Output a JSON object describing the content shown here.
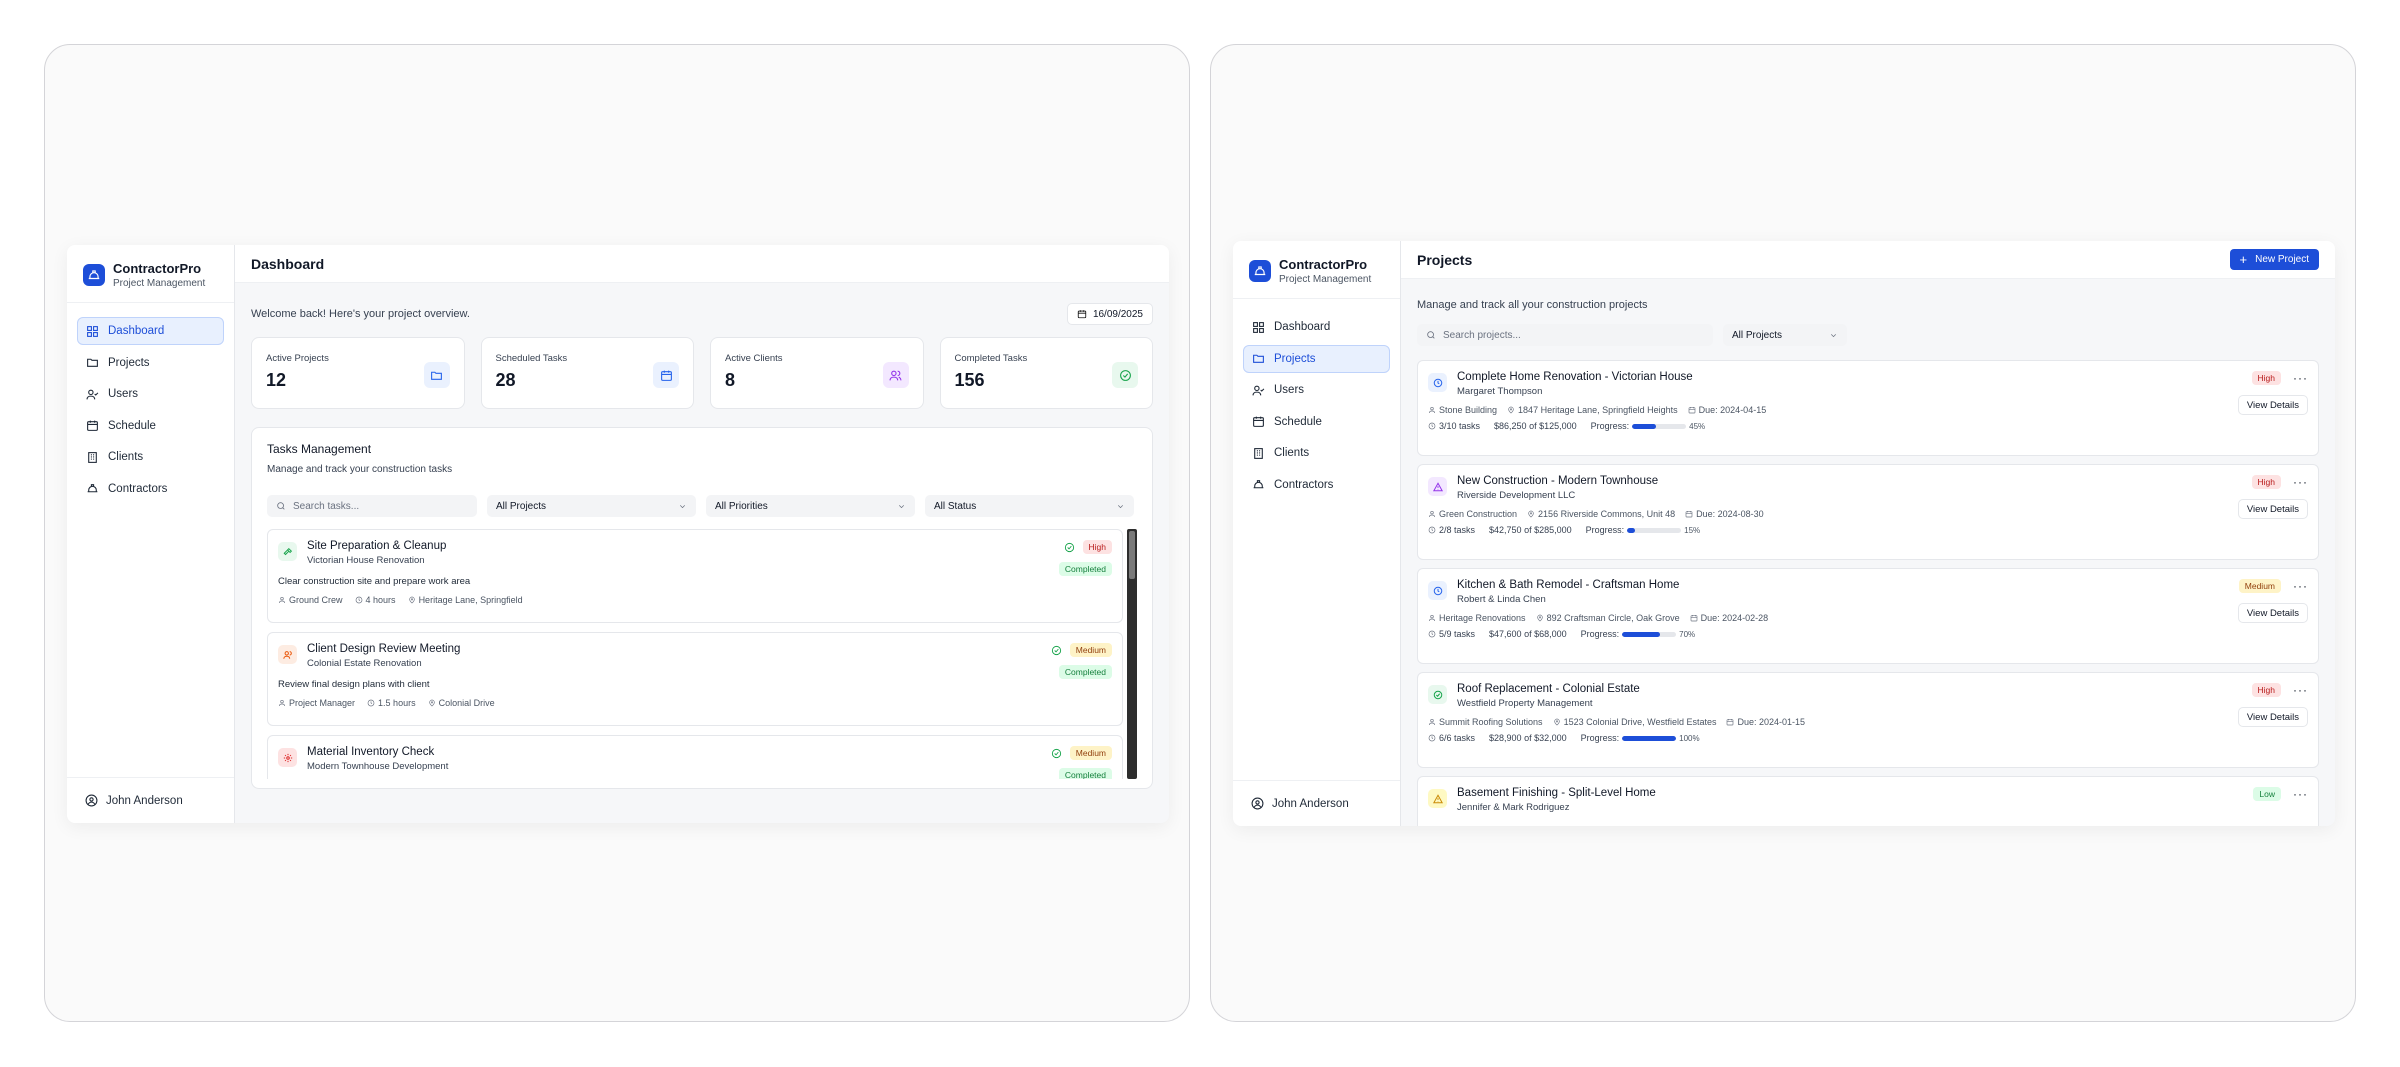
{
  "brand": {
    "name": "ContractorPro",
    "subtitle": "Project Management"
  },
  "nav": [
    "Dashboard",
    "Projects",
    "Users",
    "Schedule",
    "Clients",
    "Contractors"
  ],
  "user": "John Anderson",
  "dashboard": {
    "title": "Dashboard",
    "welcome": "Welcome back! Here's your project overview.",
    "date": "16/09/2025",
    "stats": [
      {
        "label": "Active Projects",
        "value": "12",
        "color": "#2563eb",
        "bg": "#eaf1fe"
      },
      {
        "label": "Scheduled Tasks",
        "value": "28",
        "color": "#2563eb",
        "bg": "#eaf1fe"
      },
      {
        "label": "Active Clients",
        "value": "8",
        "color": "#9333ea",
        "bg": "#f3e8ff"
      },
      {
        "label": "Completed Tasks",
        "value": "156",
        "color": "#16a34a",
        "bg": "#e8f8ee"
      }
    ],
    "tasks_title": "Tasks Management",
    "tasks_subtitle": "Manage and track your construction tasks",
    "search_placeholder": "Search tasks...",
    "filters": [
      "All Projects",
      "All Priorities",
      "All Status"
    ],
    "tasks": [
      {
        "title": "Site Preparation & Cleanup",
        "project": "Victorian House Renovation",
        "desc": "Clear construction site and prepare work area",
        "assignee": "Ground Crew",
        "duration": "4 hours",
        "location": "Heritage Lane, Springfield",
        "priority": "High",
        "status": "Completed",
        "icon": "hammer-icon"
      },
      {
        "title": "Client Design Review Meeting",
        "project": "Colonial Estate Renovation",
        "desc": "Review final design plans with client",
        "assignee": "Project Manager",
        "duration": "1.5 hours",
        "location": "Colonial Drive",
        "priority": "Medium",
        "status": "Completed",
        "icon": "users-icon"
      },
      {
        "title": "Material Inventory Check",
        "project": "Modern Townhouse Development",
        "desc": "",
        "assignee": "",
        "duration": "",
        "location": "",
        "priority": "Medium",
        "status": "Completed",
        "icon": "gear-icon"
      }
    ]
  },
  "projects": {
    "title": "Projects",
    "new_button": "New Project",
    "subtitle": "Manage and track all your construction projects",
    "search_placeholder": "Search projects...",
    "filter": "All Projects",
    "progress_label": "Progress:",
    "view_label": "View Details",
    "items": [
      {
        "title": "Complete Home Renovation - Victorian House",
        "client": "Margaret Thompson",
        "contractor": "Stone Building",
        "address": "1847 Heritage Lane, Springfield Heights",
        "due": "Due: 2024-04-15",
        "tasks": "3/10 tasks",
        "budget": "$86,250 of $125,000",
        "progress": 45,
        "progress_text": "45%",
        "priority": "High",
        "icon": "clock-icon"
      },
      {
        "title": "New Construction - Modern Townhouse",
        "client": "Riverside Development LLC",
        "contractor": "Green Construction",
        "address": "2156 Riverside Commons, Unit 48",
        "due": "Due: 2024-08-30",
        "tasks": "2/8 tasks",
        "budget": "$42,750 of $285,000",
        "progress": 15,
        "progress_text": "15%",
        "priority": "High",
        "icon": "warning-icon"
      },
      {
        "title": "Kitchen & Bath Remodel - Craftsman Home",
        "client": "Robert & Linda Chen",
        "contractor": "Heritage Renovations",
        "address": "892 Craftsman Circle, Oak Grove",
        "due": "Due: 2024-02-28",
        "tasks": "5/9 tasks",
        "budget": "$47,600 of $68,000",
        "progress": 70,
        "progress_text": "70%",
        "priority": "Medium",
        "icon": "clock-icon"
      },
      {
        "title": "Roof Replacement - Colonial Estate",
        "client": "Westfield Property Management",
        "contractor": "Summit Roofing Solutions",
        "address": "1523 Colonial Drive, Westfield Estates",
        "due": "Due: 2024-01-15",
        "tasks": "6/6 tasks",
        "budget": "$28,900 of $32,000",
        "progress": 100,
        "progress_text": "100%",
        "priority": "High",
        "icon": "check-circle-icon"
      },
      {
        "title": "Basement Finishing - Split-Level Home",
        "client": "Jennifer & Mark Rodriguez",
        "contractor": "",
        "address": "",
        "due": "",
        "tasks": "",
        "budget": "",
        "progress": 0,
        "progress_text": "",
        "priority": "Low",
        "icon": "warning-icon"
      }
    ]
  }
}
